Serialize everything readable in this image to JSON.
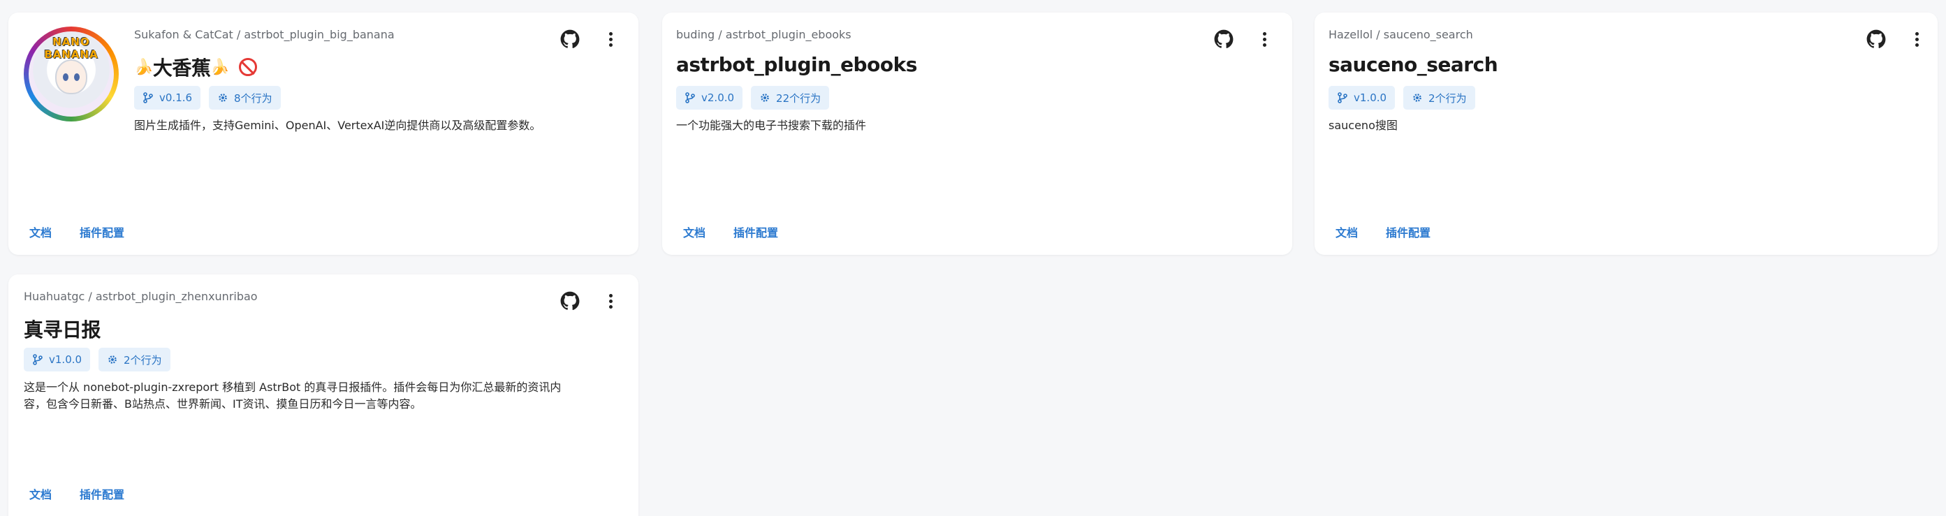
{
  "plugins": [
    {
      "owner": "Sukafon & CatCat / astrbot_plugin_big_banana",
      "title_prefix": "🍌",
      "title": "大香蕉",
      "title_suffix": "🍌",
      "avatar_text": "NANO BANANA",
      "version": "v0.1.6",
      "actions": "8个行为",
      "description": "图片生成插件，支持Gemini、OpenAI、VertexAI逆向提供商以及高级配置参数。",
      "link_docs": "文档",
      "link_config": "插件配置"
    },
    {
      "owner": "buding / astrbot_plugin_ebooks",
      "title": "astrbot_plugin_ebooks",
      "version": "v2.0.0",
      "actions": "22个行为",
      "description": "一个功能强大的电子书搜索下载的插件",
      "link_docs": "文档",
      "link_config": "插件配置"
    },
    {
      "owner": "Hazellol / sauceno_search",
      "title": "sauceno_search",
      "version": "v1.0.0",
      "actions": "2个行为",
      "description": "sauceno搜图",
      "link_docs": "文档",
      "link_config": "插件配置"
    },
    {
      "owner": "Huahuatgc / astrbot_plugin_zhenxunribao",
      "title": "真寻日报",
      "version": "v1.0.0",
      "actions": "2个行为",
      "description_line1": "这是一个从 nonebot-plugin-zxreport 移植到 AstrBot 的真寻日报插件。插件会每日为你汇总最新的资讯内",
      "description_line2": "容，包含今日新番、B站热点、世界新闻、IT资讯、摸鱼日历和今日一言等内容。",
      "link_docs": "文档",
      "link_config": "插件配置"
    }
  ],
  "icons": {
    "github": "github-icon",
    "more": "more-vert-icon",
    "version": "branch-icon",
    "actions": "gear-icon",
    "disabled": "prohibited-icon"
  },
  "colors": {
    "accent": "#2c7ad0",
    "tag_bg": "#e7f1fb",
    "page_bg": "#f6f7f9"
  }
}
